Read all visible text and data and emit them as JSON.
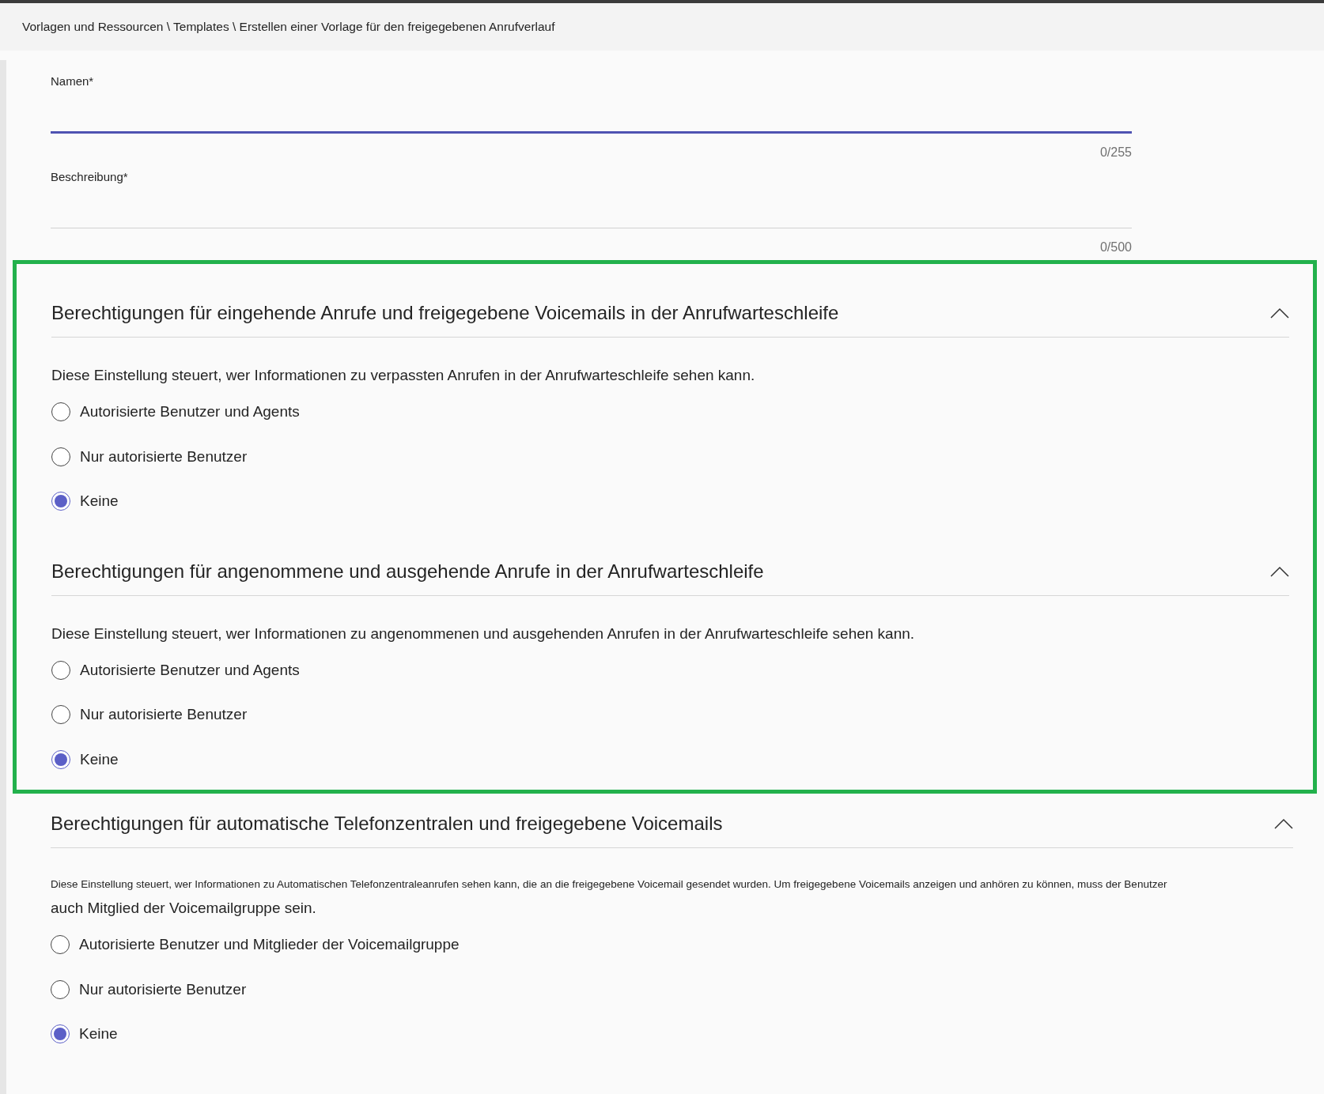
{
  "breadcrumb": "Vorlagen und Ressourcen \\ Templates \\ Erstellen einer Vorlage für den freigegebenen Anrufverlauf",
  "fields": [
    {
      "label": "Namen*",
      "counter": "0/255",
      "focused": true
    },
    {
      "label": "Beschreibung*",
      "counter": "0/500",
      "focused": false
    }
  ],
  "sections": [
    {
      "title": "Berechtigungen für eingehende Anrufe und freigegebene Voicemails in der Anrufwarteschleife",
      "expanded": true,
      "highlighted": true,
      "description": [
        "Diese Einstellung steuert, wer Informationen zu verpassten Anrufen in der Anrufwarteschleife sehen kann."
      ],
      "options": [
        {
          "label": "Autorisierte Benutzer und Agents",
          "selected": false
        },
        {
          "label": "Nur autorisierte Benutzer",
          "selected": false
        },
        {
          "label": "Keine",
          "selected": true
        }
      ]
    },
    {
      "title": "Berechtigungen für angenommene und ausgehende Anrufe in der Anrufwarteschleife",
      "expanded": true,
      "highlighted": true,
      "description": [
        "Diese Einstellung steuert, wer Informationen zu angenommenen und ausgehenden Anrufen in der Anrufwarteschleife sehen kann."
      ],
      "options": [
        {
          "label": "Autorisierte Benutzer und Agents",
          "selected": false
        },
        {
          "label": "Nur autorisierte Benutzer",
          "selected": false
        },
        {
          "label": "Keine",
          "selected": true
        }
      ]
    },
    {
      "title": "Berechtigungen für automatische Telefonzentralen und freigegebene Voicemails",
      "expanded": true,
      "highlighted": false,
      "description": [
        "Diese Einstellung steuert, wer Informationen zu Automatischen Telefonzentraleanrufen sehen kann, die an die freigegebene Voicemail gesendet wurden. Um freigegebene Voicemails anzeigen und anhören zu können, muss der Benutzer",
        "auch Mitglied der Voicemailgruppe sein."
      ],
      "options": [
        {
          "label": "Autorisierte Benutzer und Mitglieder der Voicemailgruppe",
          "selected": false
        },
        {
          "label": "Nur autorisierte Benutzer",
          "selected": false
        },
        {
          "label": "Keine",
          "selected": true
        }
      ]
    }
  ]
}
